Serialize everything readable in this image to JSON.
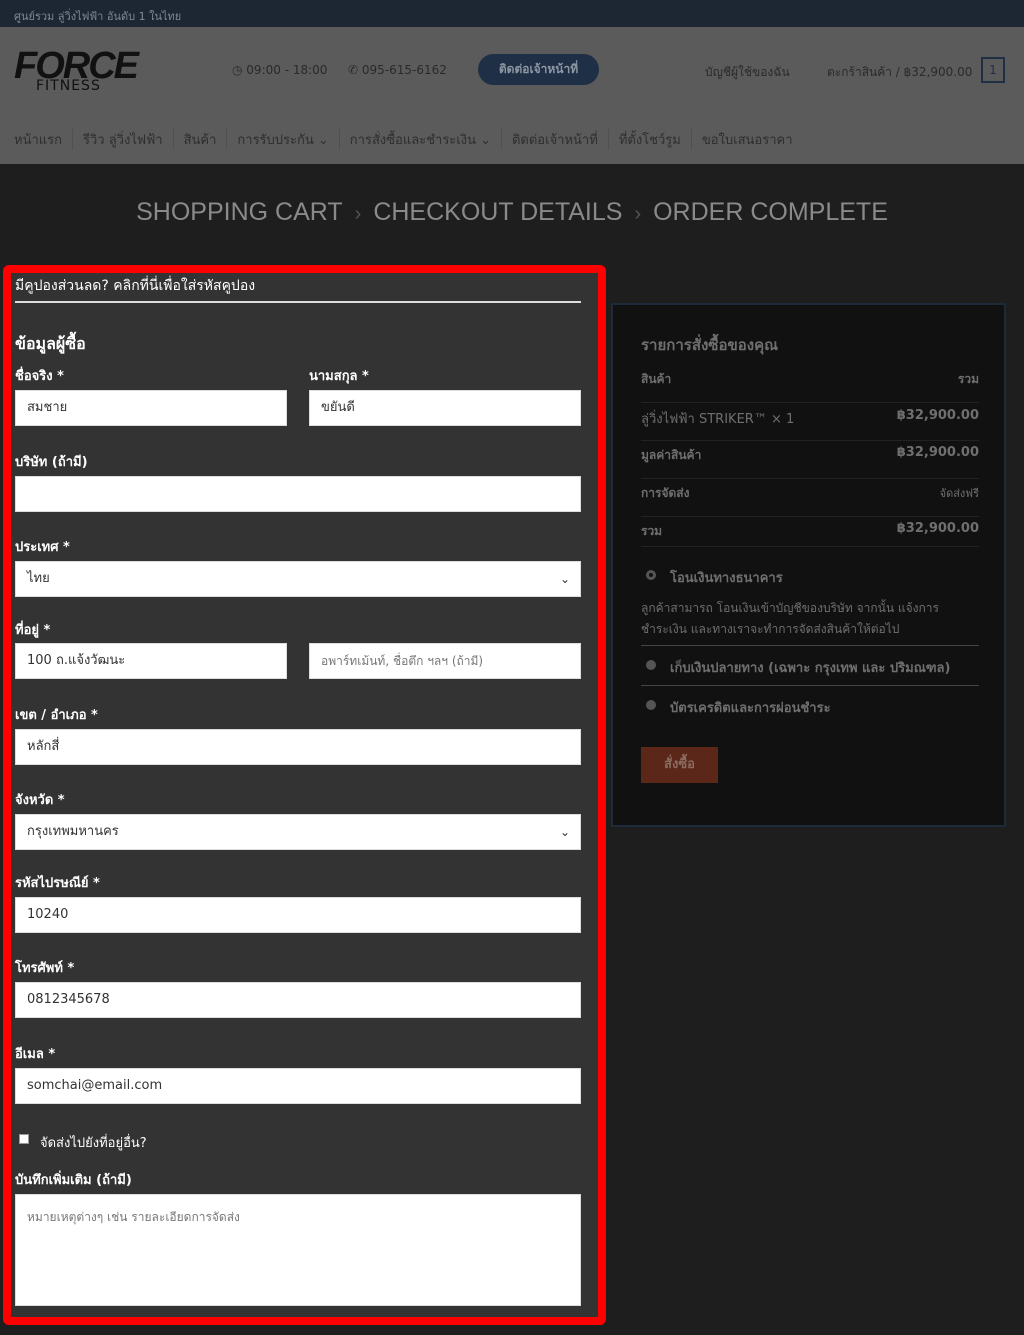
{
  "topbar": {
    "text": "ศูนย์รวม ลู่วิ่งไฟฟ้า อันดับ 1 ในไทย"
  },
  "header": {
    "logo": "FORCE",
    "logo_sub": "FITNESS",
    "hours": "09:00 - 18:00",
    "phone": "095-615-6162",
    "contact_button": "ติดต่อเจ้าหน้าที่",
    "account": "บัญชีผู้ใช้ของฉัน",
    "cart": "ตะกร้าสินค้า / ฿32,900.00",
    "cart_count": "1"
  },
  "nav": [
    "หน้าแรก",
    "รีวิว ลู่วิ่งไฟฟ้า",
    "สินค้า",
    "การรับประกัน ⌄",
    "การสั่งซื้อและชำระเงิน ⌄",
    "ติดต่อเจ้าหน้าที่",
    "ที่ตั้งโชว์รูม",
    "ขอใบเสนอราคา"
  ],
  "steps": [
    "SHOPPING CART",
    "CHECKOUT DETAILS",
    "ORDER COMPLETE"
  ],
  "form": {
    "coupon": "มีคูปองส่วนลด? คลิกที่นี่เพื่อใส่รหัสคูปอง",
    "heading": "ข้อมูลผู้ซื้อ",
    "first_name_label": "ชื่อจริง *",
    "first_name": "สมชาย",
    "last_name_label": "นามสกุล *",
    "last_name": "ขยันดี",
    "company_label": "บริษัท (ถ้ามี)",
    "company": "",
    "country_label": "ประเทศ *",
    "country": "ไทย",
    "address_label": "ที่อยู่ *",
    "address1": "100 ถ.แจ้งวัฒนะ",
    "address2_placeholder": "อพาร์ทเม้นท์, ชื่อตึก ฯลฯ (ถ้ามี)",
    "district_label": "เขต / อำเภอ *",
    "district": "หลักสี่",
    "province_label": "จังหวัด *",
    "province": "กรุงเทพมหานคร",
    "postcode_label": "รหัสไปรษณีย์ *",
    "postcode": "10240",
    "phone_label": "โทรศัพท์ *",
    "phone": "0812345678",
    "email_label": "อีเมล *",
    "email": "somchai@email.com",
    "ship_other": "จัดส่งไปยังที่อยู่อื่น?",
    "notes_label": "บันทึกเพิ่มเติม (ถ้ามี)",
    "notes_placeholder": "หมายเหตุต่างๆ เช่น รายละเอียดการจัดส่ง"
  },
  "order": {
    "title": "รายการสั่งซื้อของคุณ",
    "col_product": "สินค้า",
    "col_total": "รวม",
    "item": "ลู่วิ่งไฟฟ้า STRIKER™  × 1",
    "item_price": "฿32,900.00",
    "subtotal_label": "มูลค่าสินค้า",
    "subtotal": "฿32,900.00",
    "shipping_label": "การจัดส่ง",
    "shipping": "จัดส่งฟรี",
    "total_label": "รวม",
    "total": "฿32,900.00",
    "pay_bank": "โอนเงินทางธนาคาร",
    "pay_bank_desc1": "ลูกค้าสามารถ โอนเงินเข้าบัญชีของบริษัท จากนั้น แจ้งการ",
    "pay_bank_desc2": "ชำระเงิน และทางเราจะทำการจัดส่งสินค้าให้ต่อไป",
    "pay_cod": "เก็บเงินปลายทาง (เฉพาะ กรุงเทพ และ ปริมณฑล)",
    "pay_card": "บัตรเครดิตและการผ่อนชำระ",
    "place_order": "สั่งซื้อ"
  },
  "colors": {
    "highlight": "#ff0000",
    "order_button": "#5a2718",
    "contact_button": "#1f2f45"
  }
}
